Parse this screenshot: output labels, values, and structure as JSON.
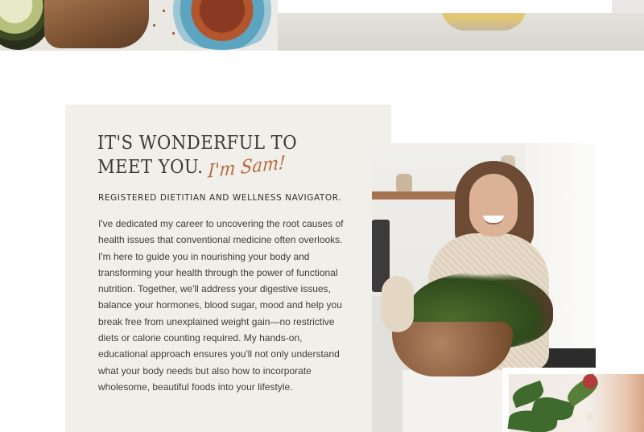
{
  "hero": {
    "image_name": "food-flatlay-photo"
  },
  "intro": {
    "headline": "IT'S WONDERFUL TO MEET YOU.",
    "signature": "I'm Sam!",
    "subtitle": "REGISTERED DIETITIAN AND WELLNESS NAVIGATOR.",
    "bio": "I've dedicated my career to uncovering the root causes of health issues that conventional medicine often overlooks. I'm here to guide you in nourishing your body and transforming your health through the power of functional nutrition. Together, we'll address your digestive issues, balance your hormones, blood sugar, mood and help you break free from unexplained weight gain—no restrictive diets or calorie counting required. My hands-on, educational approach ensures you'll not only understand what your body needs but also how to incorporate wholesome, beautiful foods into your lifestyle."
  },
  "photos": {
    "portrait_name": "portrait-photo",
    "bouquet_name": "bouquet-photo"
  },
  "colors": {
    "card_background": "#f0efea",
    "signature": "#b86a3a",
    "heading_text": "#3a3a37",
    "body_text": "#3d3d3a"
  }
}
